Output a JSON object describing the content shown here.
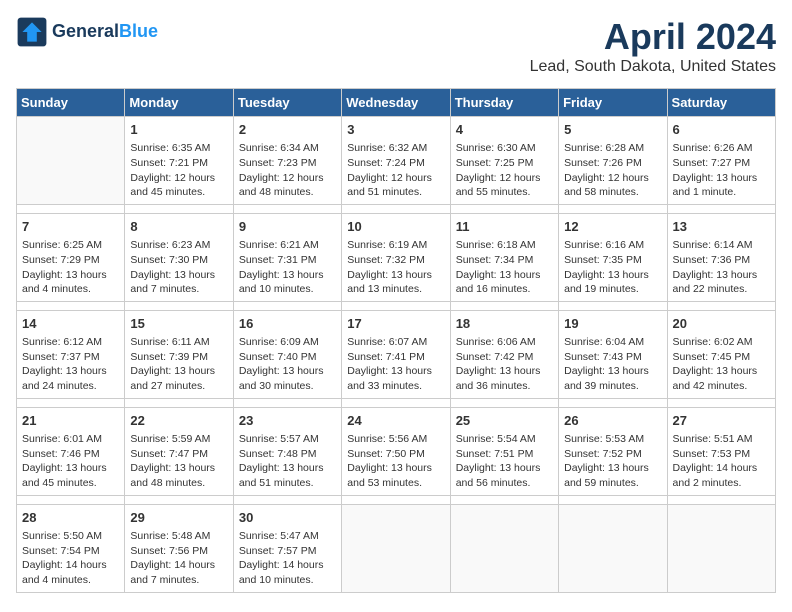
{
  "header": {
    "logo_line1": "General",
    "logo_line2": "Blue",
    "title": "April 2024",
    "subtitle": "Lead, South Dakota, United States"
  },
  "weekdays": [
    "Sunday",
    "Monday",
    "Tuesday",
    "Wednesday",
    "Thursday",
    "Friday",
    "Saturday"
  ],
  "weeks": [
    [
      {
        "day": "",
        "info": ""
      },
      {
        "day": "1",
        "info": "Sunrise: 6:35 AM\nSunset: 7:21 PM\nDaylight: 12 hours\nand 45 minutes."
      },
      {
        "day": "2",
        "info": "Sunrise: 6:34 AM\nSunset: 7:23 PM\nDaylight: 12 hours\nand 48 minutes."
      },
      {
        "day": "3",
        "info": "Sunrise: 6:32 AM\nSunset: 7:24 PM\nDaylight: 12 hours\nand 51 minutes."
      },
      {
        "day": "4",
        "info": "Sunrise: 6:30 AM\nSunset: 7:25 PM\nDaylight: 12 hours\nand 55 minutes."
      },
      {
        "day": "5",
        "info": "Sunrise: 6:28 AM\nSunset: 7:26 PM\nDaylight: 12 hours\nand 58 minutes."
      },
      {
        "day": "6",
        "info": "Sunrise: 6:26 AM\nSunset: 7:27 PM\nDaylight: 13 hours\nand 1 minute."
      }
    ],
    [
      {
        "day": "7",
        "info": "Sunrise: 6:25 AM\nSunset: 7:29 PM\nDaylight: 13 hours\nand 4 minutes."
      },
      {
        "day": "8",
        "info": "Sunrise: 6:23 AM\nSunset: 7:30 PM\nDaylight: 13 hours\nand 7 minutes."
      },
      {
        "day": "9",
        "info": "Sunrise: 6:21 AM\nSunset: 7:31 PM\nDaylight: 13 hours\nand 10 minutes."
      },
      {
        "day": "10",
        "info": "Sunrise: 6:19 AM\nSunset: 7:32 PM\nDaylight: 13 hours\nand 13 minutes."
      },
      {
        "day": "11",
        "info": "Sunrise: 6:18 AM\nSunset: 7:34 PM\nDaylight: 13 hours\nand 16 minutes."
      },
      {
        "day": "12",
        "info": "Sunrise: 6:16 AM\nSunset: 7:35 PM\nDaylight: 13 hours\nand 19 minutes."
      },
      {
        "day": "13",
        "info": "Sunrise: 6:14 AM\nSunset: 7:36 PM\nDaylight: 13 hours\nand 22 minutes."
      }
    ],
    [
      {
        "day": "14",
        "info": "Sunrise: 6:12 AM\nSunset: 7:37 PM\nDaylight: 13 hours\nand 24 minutes."
      },
      {
        "day": "15",
        "info": "Sunrise: 6:11 AM\nSunset: 7:39 PM\nDaylight: 13 hours\nand 27 minutes."
      },
      {
        "day": "16",
        "info": "Sunrise: 6:09 AM\nSunset: 7:40 PM\nDaylight: 13 hours\nand 30 minutes."
      },
      {
        "day": "17",
        "info": "Sunrise: 6:07 AM\nSunset: 7:41 PM\nDaylight: 13 hours\nand 33 minutes."
      },
      {
        "day": "18",
        "info": "Sunrise: 6:06 AM\nSunset: 7:42 PM\nDaylight: 13 hours\nand 36 minutes."
      },
      {
        "day": "19",
        "info": "Sunrise: 6:04 AM\nSunset: 7:43 PM\nDaylight: 13 hours\nand 39 minutes."
      },
      {
        "day": "20",
        "info": "Sunrise: 6:02 AM\nSunset: 7:45 PM\nDaylight: 13 hours\nand 42 minutes."
      }
    ],
    [
      {
        "day": "21",
        "info": "Sunrise: 6:01 AM\nSunset: 7:46 PM\nDaylight: 13 hours\nand 45 minutes."
      },
      {
        "day": "22",
        "info": "Sunrise: 5:59 AM\nSunset: 7:47 PM\nDaylight: 13 hours\nand 48 minutes."
      },
      {
        "day": "23",
        "info": "Sunrise: 5:57 AM\nSunset: 7:48 PM\nDaylight: 13 hours\nand 51 minutes."
      },
      {
        "day": "24",
        "info": "Sunrise: 5:56 AM\nSunset: 7:50 PM\nDaylight: 13 hours\nand 53 minutes."
      },
      {
        "day": "25",
        "info": "Sunrise: 5:54 AM\nSunset: 7:51 PM\nDaylight: 13 hours\nand 56 minutes."
      },
      {
        "day": "26",
        "info": "Sunrise: 5:53 AM\nSunset: 7:52 PM\nDaylight: 13 hours\nand 59 minutes."
      },
      {
        "day": "27",
        "info": "Sunrise: 5:51 AM\nSunset: 7:53 PM\nDaylight: 14 hours\nand 2 minutes."
      }
    ],
    [
      {
        "day": "28",
        "info": "Sunrise: 5:50 AM\nSunset: 7:54 PM\nDaylight: 14 hours\nand 4 minutes."
      },
      {
        "day": "29",
        "info": "Sunrise: 5:48 AM\nSunset: 7:56 PM\nDaylight: 14 hours\nand 7 minutes."
      },
      {
        "day": "30",
        "info": "Sunrise: 5:47 AM\nSunset: 7:57 PM\nDaylight: 14 hours\nand 10 minutes."
      },
      {
        "day": "",
        "info": ""
      },
      {
        "day": "",
        "info": ""
      },
      {
        "day": "",
        "info": ""
      },
      {
        "day": "",
        "info": ""
      }
    ]
  ]
}
